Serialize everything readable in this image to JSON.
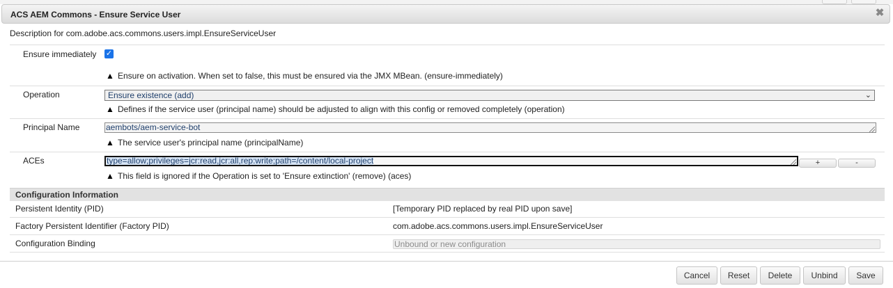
{
  "dialog": {
    "title": "ACS AEM Commons - Ensure Service User",
    "description": "Description for com.adobe.acs.commons.users.impl.EnsureServiceUser"
  },
  "fields": {
    "ensure_immediately": {
      "label": "Ensure immediately",
      "checked": true,
      "help": "Ensure on activation. When set to false, this must be ensured via the JMX MBean. (ensure-immediately)"
    },
    "operation": {
      "label": "Operation",
      "value": "Ensure existence (add)",
      "help": "Defines if the service user (principal name) should be adjusted to align with this config or removed completely (operation)"
    },
    "principal_name": {
      "label": "Principal Name",
      "value": "aembots/aem-service-bot",
      "help": "The service user's principal name (principalName)"
    },
    "aces": {
      "label": "ACEs",
      "value": "type=allow;privileges=jcr:read,jcr:all,rep:write;path=/content/local-project",
      "add_label": "+",
      "remove_label": "-",
      "help": "This field is ignored if the Operation is set to 'Ensure extinction' (remove) (aces)"
    }
  },
  "config_info": {
    "heading": "Configuration Information",
    "pid_label": "Persistent Identity (PID)",
    "pid_value": "[Temporary PID replaced by real PID upon save]",
    "factory_pid_label": "Factory Persistent Identifier (Factory PID)",
    "factory_pid_value": "com.adobe.acs.commons.users.impl.EnsureServiceUser",
    "binding_label": "Configuration Binding",
    "binding_placeholder": "Unbound or new configuration"
  },
  "footer": {
    "cancel": "Cancel",
    "reset": "Reset",
    "delete": "Delete",
    "unbind": "Unbind",
    "save": "Save"
  },
  "icons": {
    "warning": "warning-icon",
    "close": "close-icon",
    "check": "checkmark-icon",
    "dropdown": "chevron-down-icon"
  },
  "colors": {
    "checkbox": "#1a73e8",
    "field_text": "#1f3f6b"
  }
}
